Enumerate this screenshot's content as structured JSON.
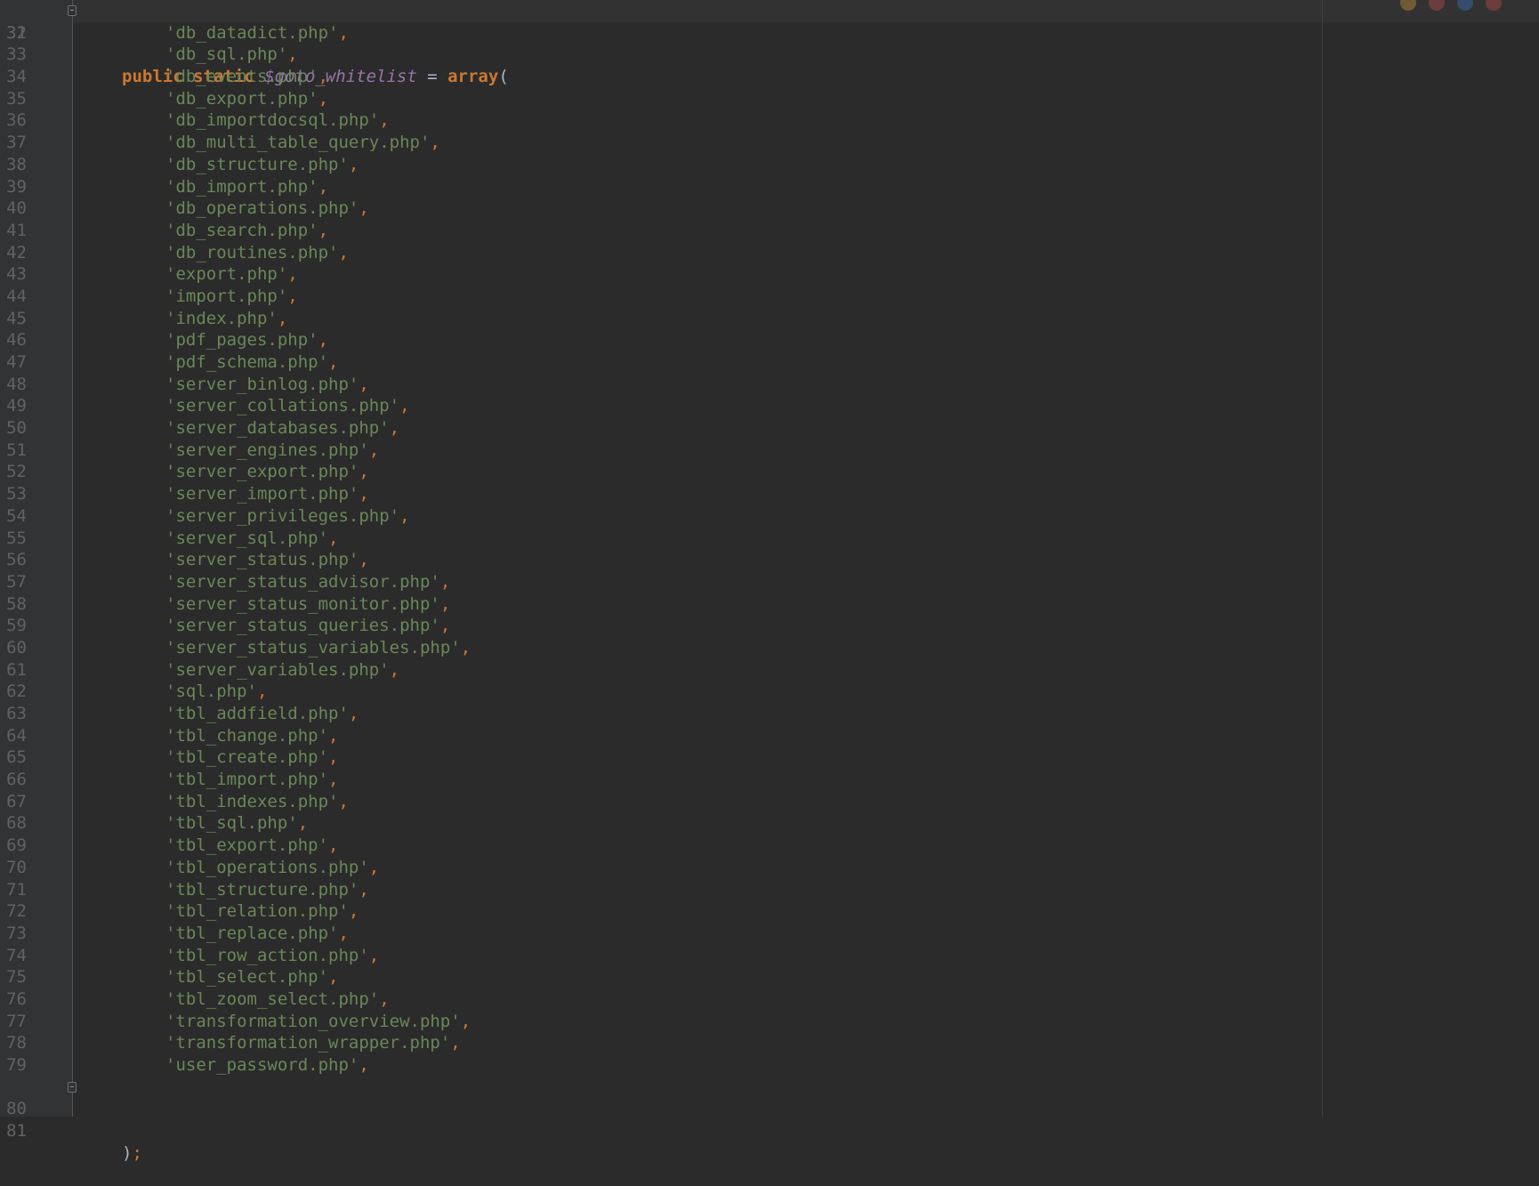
{
  "editor": {
    "colors": {
      "background": "#2b2b2b",
      "gutter": "#313335",
      "line_number": "#606366",
      "keyword": "#cc7832",
      "variable": "#9876aa",
      "string": "#6a8759",
      "text": "#a9b7c6"
    },
    "declaration": {
      "line_number": "31",
      "kw_public": "public",
      "kw_static": "static",
      "variable": "$goto_whitelist",
      "operator": " = ",
      "kw_array": "array",
      "open_paren": "("
    },
    "entries": [
      {
        "n": "32",
        "s": "'db_datadict.php'"
      },
      {
        "n": "33",
        "s": "'db_sql.php'"
      },
      {
        "n": "34",
        "s": "'db_events.php'"
      },
      {
        "n": "35",
        "s": "'db_export.php'"
      },
      {
        "n": "36",
        "s": "'db_importdocsql.php'"
      },
      {
        "n": "37",
        "s": "'db_multi_table_query.php'"
      },
      {
        "n": "38",
        "s": "'db_structure.php'"
      },
      {
        "n": "39",
        "s": "'db_import.php'"
      },
      {
        "n": "40",
        "s": "'db_operations.php'"
      },
      {
        "n": "41",
        "s": "'db_search.php'"
      },
      {
        "n": "42",
        "s": "'db_routines.php'"
      },
      {
        "n": "43",
        "s": "'export.php'"
      },
      {
        "n": "44",
        "s": "'import.php'"
      },
      {
        "n": "45",
        "s": "'index.php'"
      },
      {
        "n": "46",
        "s": "'pdf_pages.php'"
      },
      {
        "n": "47",
        "s": "'pdf_schema.php'"
      },
      {
        "n": "48",
        "s": "'server_binlog.php'"
      },
      {
        "n": "49",
        "s": "'server_collations.php'"
      },
      {
        "n": "50",
        "s": "'server_databases.php'"
      },
      {
        "n": "51",
        "s": "'server_engines.php'"
      },
      {
        "n": "52",
        "s": "'server_export.php'"
      },
      {
        "n": "53",
        "s": "'server_import.php'"
      },
      {
        "n": "54",
        "s": "'server_privileges.php'"
      },
      {
        "n": "55",
        "s": "'server_sql.php'"
      },
      {
        "n": "56",
        "s": "'server_status.php'"
      },
      {
        "n": "57",
        "s": "'server_status_advisor.php'"
      },
      {
        "n": "58",
        "s": "'server_status_monitor.php'"
      },
      {
        "n": "59",
        "s": "'server_status_queries.php'"
      },
      {
        "n": "60",
        "s": "'server_status_variables.php'"
      },
      {
        "n": "61",
        "s": "'server_variables.php'"
      },
      {
        "n": "62",
        "s": "'sql.php'"
      },
      {
        "n": "63",
        "s": "'tbl_addfield.php'"
      },
      {
        "n": "64",
        "s": "'tbl_change.php'"
      },
      {
        "n": "65",
        "s": "'tbl_create.php'"
      },
      {
        "n": "66",
        "s": "'tbl_import.php'"
      },
      {
        "n": "67",
        "s": "'tbl_indexes.php'"
      },
      {
        "n": "68",
        "s": "'tbl_sql.php'"
      },
      {
        "n": "69",
        "s": "'tbl_export.php'"
      },
      {
        "n": "70",
        "s": "'tbl_operations.php'"
      },
      {
        "n": "71",
        "s": "'tbl_structure.php'"
      },
      {
        "n": "72",
        "s": "'tbl_relation.php'"
      },
      {
        "n": "73",
        "s": "'tbl_replace.php'"
      },
      {
        "n": "74",
        "s": "'tbl_row_action.php'"
      },
      {
        "n": "75",
        "s": "'tbl_select.php'"
      },
      {
        "n": "76",
        "s": "'tbl_zoom_select.php'"
      },
      {
        "n": "77",
        "s": "'transformation_overview.php'"
      },
      {
        "n": "78",
        "s": "'transformation_wrapper.php'"
      },
      {
        "n": "79",
        "s": "'user_password.php'"
      }
    ],
    "entry_separator": ",",
    "closing": {
      "line_number": "80",
      "close_paren": ")",
      "semicolon": ";"
    },
    "empty_line": {
      "line_number": "81"
    },
    "browser_icon_colors": [
      "#e8a33d",
      "#d9534f",
      "#3b7dd8",
      "#d9534f"
    ]
  }
}
